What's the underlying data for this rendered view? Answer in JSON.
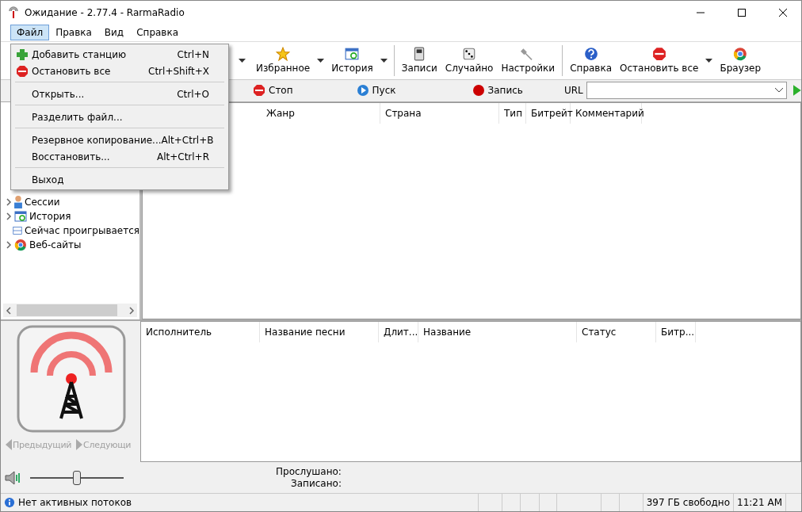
{
  "window": {
    "title": "Ожидание - 2.77.4 - RarmaRadio"
  },
  "menubar": [
    {
      "label": "Файл",
      "selected": true
    },
    {
      "label": "Правка",
      "selected": false
    },
    {
      "label": "Вид",
      "selected": false
    },
    {
      "label": "Справка",
      "selected": false
    }
  ],
  "file_menu": [
    [
      {
        "label": "Добавить станцию",
        "shortcut": "Ctrl+N",
        "kind": "add"
      },
      {
        "label": "Остановить все",
        "shortcut": "Ctrl+Shift+X",
        "kind": "stop"
      }
    ],
    [
      {
        "label": "Открыть...",
        "shortcut": "Ctrl+O"
      }
    ],
    [
      {
        "label": "Разделить файл..."
      }
    ],
    [
      {
        "label": "Резервное копирование...",
        "shortcut": "Alt+Ctrl+B"
      },
      {
        "label": "Восстановить...",
        "shortcut": "Alt+Ctrl+R"
      }
    ],
    [
      {
        "label": "Выход"
      }
    ]
  ],
  "toolbar": {
    "groups": [
      [
        {
          "label": "Избранное",
          "kind": "star",
          "has_menu": true
        },
        {
          "label": "История",
          "kind": "history",
          "has_menu": true
        }
      ],
      [
        {
          "label": "Записи",
          "kind": "player",
          "has_menu": false
        },
        {
          "label": "Случайно",
          "kind": "dice",
          "has_menu": false
        },
        {
          "label": "Настройки",
          "kind": "wrench",
          "has_menu": false
        }
      ],
      [
        {
          "label": "Справка",
          "kind": "help",
          "has_menu": false
        },
        {
          "label": "Остановить все",
          "kind": "stop",
          "has_menu": true
        },
        {
          "label": "Браузер",
          "kind": "browser",
          "has_menu": false
        }
      ]
    ]
  },
  "playbar": {
    "buttons": [
      {
        "label": "Стоп",
        "kind": "stop"
      },
      {
        "label": "Пуск",
        "kind": "play"
      },
      {
        "label": "Запись",
        "kind": "record"
      }
    ],
    "url_label": "URL"
  },
  "tree": [
    {
      "label": "Сессии",
      "kind": "sessions",
      "expandable": true
    },
    {
      "label": "История",
      "kind": "history",
      "expandable": true
    },
    {
      "label": "Сейчас проигрывается",
      "kind": "window",
      "expandable": false
    },
    {
      "label": "Веб-сайты",
      "kind": "browser",
      "expandable": true
    }
  ],
  "stations_table": {
    "columns": [
      "Жанр",
      "Страна",
      "Тип",
      "Битрейт",
      "Комментарий"
    ]
  },
  "playlist_table": {
    "columns": [
      "Исполнитель",
      "Название песни",
      "Длит...",
      "Название",
      "Статус",
      "Битр..."
    ]
  },
  "navigation": [
    {
      "label": "Предыдущий",
      "disabled": true
    },
    {
      "label": "Следующи",
      "disabled": true
    }
  ],
  "volume": {
    "level": 0.5
  },
  "stats": [
    "Прослушано:",
    "Записано:"
  ],
  "status_bar": {
    "message": "Нет активных потоков",
    "free_space": "397 ГБ свободно",
    "time": "11:21 AM"
  }
}
